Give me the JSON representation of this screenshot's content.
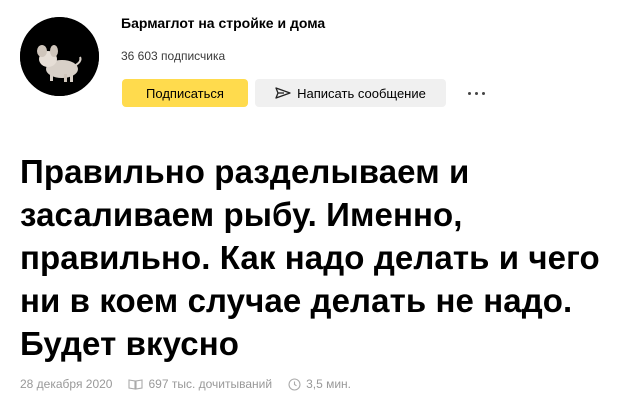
{
  "channel": {
    "name": "Бармаглот на стройке и дома",
    "subscribers": "36 603 подписчика"
  },
  "actions": {
    "subscribe_label": "Подписаться",
    "message_label": "Написать сообщение",
    "more_icon": "more-dots-icon"
  },
  "article": {
    "title": "Правильно разделываем и засаливаем рыбу. Именно, правильно. Как надо делать и чего ни в коем случае делать не надо. Будет вкусно",
    "date": "28 декабря 2020",
    "reads": "697 тыс. дочитываний",
    "read_time": "3,5 мин."
  },
  "colors": {
    "subscribe_bg": "#ffdb4d",
    "message_bg": "#f0f0f0",
    "meta_text": "#999999"
  }
}
